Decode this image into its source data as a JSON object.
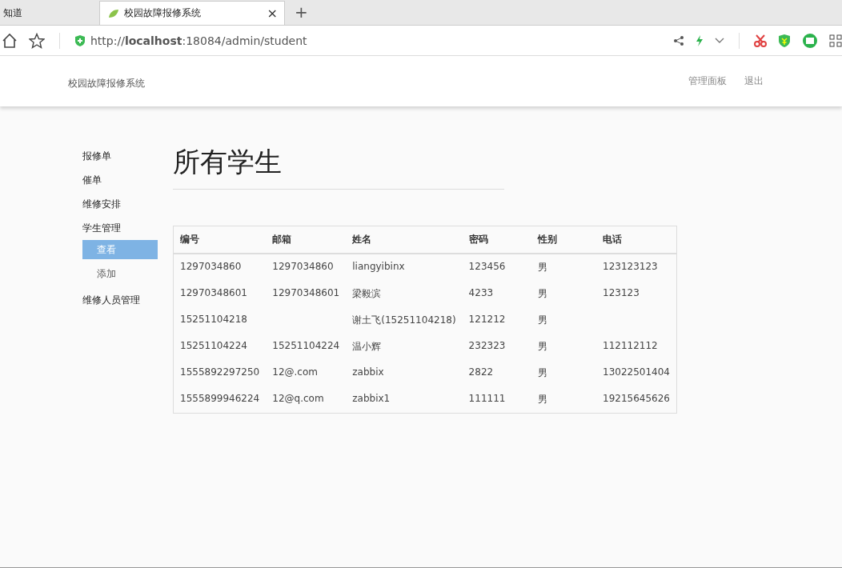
{
  "browser": {
    "tabs": [
      {
        "title": "知道",
        "selected": false
      },
      {
        "title": "校园故障报修系统",
        "selected": true
      }
    ],
    "new_tab": "+",
    "close": "×",
    "url": "http://**localhost**:18084/admin/student"
  },
  "navbar": {
    "brand": "校园故障报修系统",
    "links": [
      "管理面板",
      "退出"
    ]
  },
  "sidebar": {
    "items": [
      {
        "label": "报修单",
        "selected": false
      },
      {
        "label": "催单",
        "selected": false
      },
      {
        "label": "维修安排",
        "selected": false
      },
      {
        "label": "学生管理",
        "selected": false,
        "children": [
          {
            "label": "查看",
            "selected": true
          },
          {
            "label": "添加",
            "selected": false
          }
        ]
      },
      {
        "label": "维修人员管理",
        "selected": false
      }
    ]
  },
  "page_title": "所有学生",
  "table": {
    "columns": [
      "编号",
      "邮箱",
      "姓名",
      "密码",
      "性别",
      "电话"
    ],
    "rows": [
      [
        "1297034860",
        "1297034860",
        "liangyibinx",
        "123456",
        "男",
        "123123123"
      ],
      [
        "12970348601",
        "12970348601",
        "梁毅滨",
        "4233",
        "男",
        "123123"
      ],
      [
        "15251104218",
        "",
        "谢土飞(15251104218)",
        "121212",
        "男",
        ""
      ],
      [
        "15251104224",
        "15251104224",
        "温小辉",
        "232323",
        "男",
        "112112112"
      ],
      [
        "1555892297250",
        "12@.com",
        "zabbix",
        "2822",
        "男",
        "13022501404"
      ],
      [
        "1555899946224",
        "12@q.com",
        "zabbix1",
        "111111",
        "男",
        "19215645626"
      ]
    ]
  }
}
